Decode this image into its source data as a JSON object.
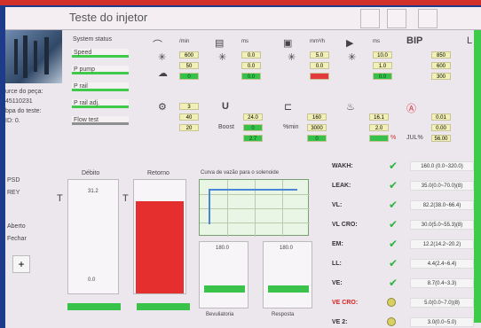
{
  "window": {
    "title": "Teste do injetor"
  },
  "left": {
    "line1": "urce do peça:",
    "line2": "45110231",
    "line3": "bpa do teste:",
    "line4": "ID: 0.",
    "radio1": "PSD",
    "radio2": "REY",
    "check1": "Aberto",
    "check2": "Fechar",
    "plus": "+"
  },
  "status": {
    "title": "System status",
    "items": [
      "Speed",
      "P pump",
      "P rail",
      "P rail adj.",
      "Flow test"
    ]
  },
  "top_params": {
    "p1": {
      "h": "/min",
      "v": [
        "600",
        "50",
        "0"
      ],
      "s": ""
    },
    "p2": {
      "h": "ms",
      "v": [
        "0.0",
        "0.0",
        "0.0"
      ],
      "s": ""
    },
    "p3": {
      "h": "mm³/h",
      "v": [
        "5.0",
        "0.0",
        ""
      ],
      "s": ""
    },
    "p4": {
      "h": "ms",
      "v": [
        "10.0",
        "1.0",
        "0.0"
      ],
      "s": ""
    },
    "p5": {
      "h": "BIP",
      "v": [
        "850",
        "600",
        "300"
      ],
      "s": ""
    },
    "p6": {
      "h": "L",
      "v": [
        "",
        "",
        ""
      ],
      "s": ""
    }
  },
  "mid_params": {
    "q1": {
      "v": [
        "3",
        "40",
        "20"
      ]
    },
    "q2": {
      "v": [
        "24.0",
        "0",
        "2.7"
      ],
      "label": "Boost"
    },
    "q3": {
      "v": [
        "160",
        "3000",
        "0"
      ],
      "label": "%min"
    },
    "q4": {
      "v": [
        "16.1",
        "2.0",
        ""
      ],
      "label": "%"
    },
    "q5": {
      "v": [
        "0.01",
        "0.00",
        "56.00"
      ],
      "label": "JUL%"
    }
  },
  "bottom": {
    "col1": {
      "title": "Débito",
      "top": "31.2",
      "bot": "0.0"
    },
    "col2": {
      "title": "Retorno"
    },
    "chart": {
      "title": "Curva de vazão para o solenoide"
    },
    "small1": {
      "title": "180.0",
      "label": "Bevuliatoria"
    },
    "small2": {
      "title": "180.0",
      "label": "Resposta"
    }
  },
  "results": [
    {
      "name": "WAKH:",
      "value": "160.0 (0.0~320.0)"
    },
    {
      "name": "LEAK:",
      "value": "35.0(0.0~70.0)(8)"
    },
    {
      "name": "VL:",
      "value": "82.2(38.0~66.4)"
    },
    {
      "name": "VL CRO:",
      "value": "30.0(5.0~55.3)(8)"
    },
    {
      "name": "EM:",
      "value": "12.2(14.2~20.2)"
    },
    {
      "name": "LL:",
      "value": "4.4(2.4~6.4)"
    },
    {
      "name": "VE:",
      "value": "8.7(0.4~3.3)"
    },
    {
      "name": "VE CRO:",
      "value": "5.0(0.0~7.0)(8)"
    },
    {
      "name": "VE 2:",
      "value": "3.0(0.0~5.0)"
    }
  ]
}
